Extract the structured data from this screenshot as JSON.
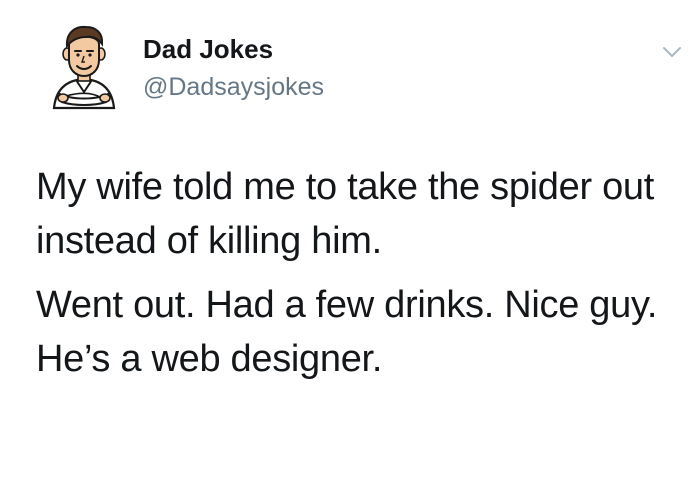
{
  "tweet": {
    "author": {
      "display_name": "Dad Jokes",
      "handle": "@Dadsaysjokes",
      "avatar_icon": "dad-cartoon-avatar-icon"
    },
    "menu_icon": "chevron-down-icon",
    "lines_para1": [
      "My wife told me to take the spider out",
      "instead of killing him."
    ],
    "lines_para2": [
      "Went out. Had a few drinks. Nice guy.",
      "He’s a web designer."
    ]
  }
}
